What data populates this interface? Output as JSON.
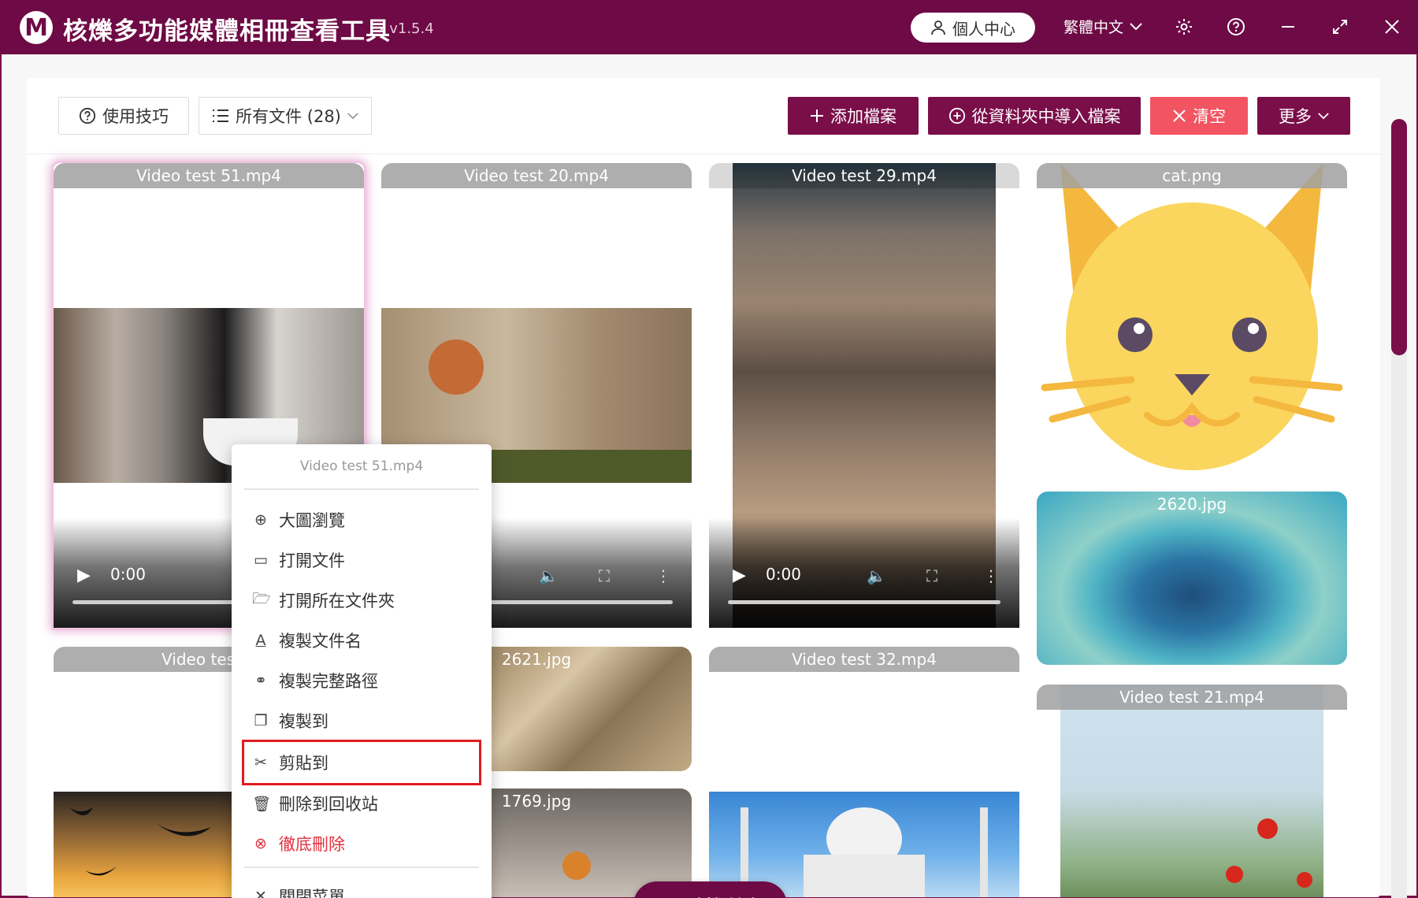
{
  "app": {
    "logo_letter": "M",
    "title": "核爍多功能媒體相冊查看工具",
    "version": "- v1.5.4",
    "user_center": "個人中心",
    "language": "繁體中文"
  },
  "toolbar": {
    "tips_label": "使用技巧",
    "filter_label": "所有文件 (28)",
    "add_label": "添加檔案",
    "import_label": "從資料夾中導入檔案",
    "clear_label": "清空",
    "more_label": "更多"
  },
  "cards": {
    "c1": {
      "label": "Video test 51.mp4",
      "time": "0:00"
    },
    "c2": {
      "label": "Video test 20.mp4"
    },
    "c3": {
      "label": "Video test 29.mp4",
      "time": "0:00"
    },
    "c4": {
      "label": "cat.png"
    },
    "c5": {
      "label": "2620.jpg"
    },
    "c6": {
      "label": "Video test 2"
    },
    "c7": {
      "label": "2621.jpg"
    },
    "c8": {
      "label": "Video test 32.mp4"
    },
    "c9": {
      "label": "Video test 21.mp4"
    },
    "c10": {
      "label": "1769.jpg"
    }
  },
  "context_menu": {
    "title": "Video test 51.mp4",
    "items": {
      "preview": "大圖瀏覽",
      "open_file": "打開文件",
      "open_folder": "打開所在文件夾",
      "copy_name": "複製文件名",
      "copy_path": "複製完整路徑",
      "copy_to": "複製到",
      "cut_to": "剪貼到",
      "recycle": "刪除到回收站",
      "delete": "徹底刪除",
      "close": "關閉菜單"
    }
  },
  "random_browse": "隨機瀏覽",
  "colors": {
    "brand": "#6e0a45",
    "danger": "#f25461",
    "highlight": "#e11b22"
  }
}
